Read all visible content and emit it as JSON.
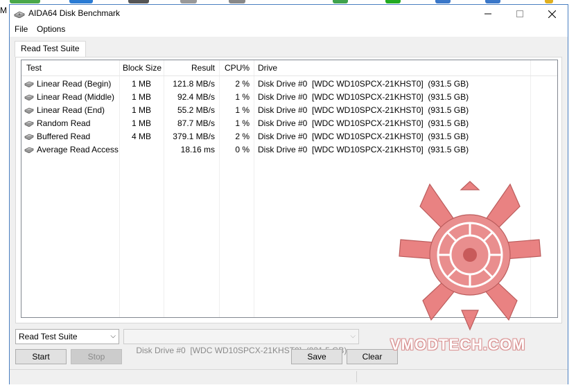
{
  "window": {
    "title": "AIDA64 Disk Benchmark",
    "background_letter": "M"
  },
  "menu": [
    "File",
    "Options"
  ],
  "tabs": [
    {
      "label": "Read Test Suite",
      "active": true
    }
  ],
  "table": {
    "columns": [
      "Test",
      "Block Size",
      "Result",
      "CPU%",
      "Drive"
    ],
    "rows": [
      {
        "test": "Linear Read (Begin)",
        "block_size": "1 MB",
        "result": "121.8 MB/s",
        "cpu": "2 %",
        "drive": "Disk Drive #0  [WDC WD10SPCX-21KHST0]  (931.5 GB)"
      },
      {
        "test": "Linear Read (Middle)",
        "block_size": "1 MB",
        "result": "92.4 MB/s",
        "cpu": "1 %",
        "drive": "Disk Drive #0  [WDC WD10SPCX-21KHST0]  (931.5 GB)"
      },
      {
        "test": "Linear Read (End)",
        "block_size": "1 MB",
        "result": "55.2 MB/s",
        "cpu": "1 %",
        "drive": "Disk Drive #0  [WDC WD10SPCX-21KHST0]  (931.5 GB)"
      },
      {
        "test": "Random Read",
        "block_size": "1 MB",
        "result": "87.7 MB/s",
        "cpu": "1 %",
        "drive": "Disk Drive #0  [WDC WD10SPCX-21KHST0]  (931.5 GB)"
      },
      {
        "test": "Buffered Read",
        "block_size": "4 MB",
        "result": "379.1 MB/s",
        "cpu": "2 %",
        "drive": "Disk Drive #0  [WDC WD10SPCX-21KHST0]  (931.5 GB)"
      },
      {
        "test": "Average Read Access",
        "block_size": "",
        "result": "18.16 ms",
        "cpu": "0 %",
        "drive": "Disk Drive #0  [WDC WD10SPCX-21KHST0]  (931.5 GB)"
      }
    ]
  },
  "controls": {
    "test_select": "Read Test Suite",
    "drive_select": "Disk Drive #0  [WDC WD10SPCX-21KHST0]  (931.5 GB)",
    "start_label": "Start",
    "stop_label": "Stop",
    "save_label": "Save",
    "clear_label": "Clear"
  },
  "watermark": {
    "text": "VMODTECH.COM",
    "color": "#e87c7c"
  },
  "colors": {
    "window_border": "#4a7fc1",
    "panel_bg": "#f0f0f0"
  }
}
